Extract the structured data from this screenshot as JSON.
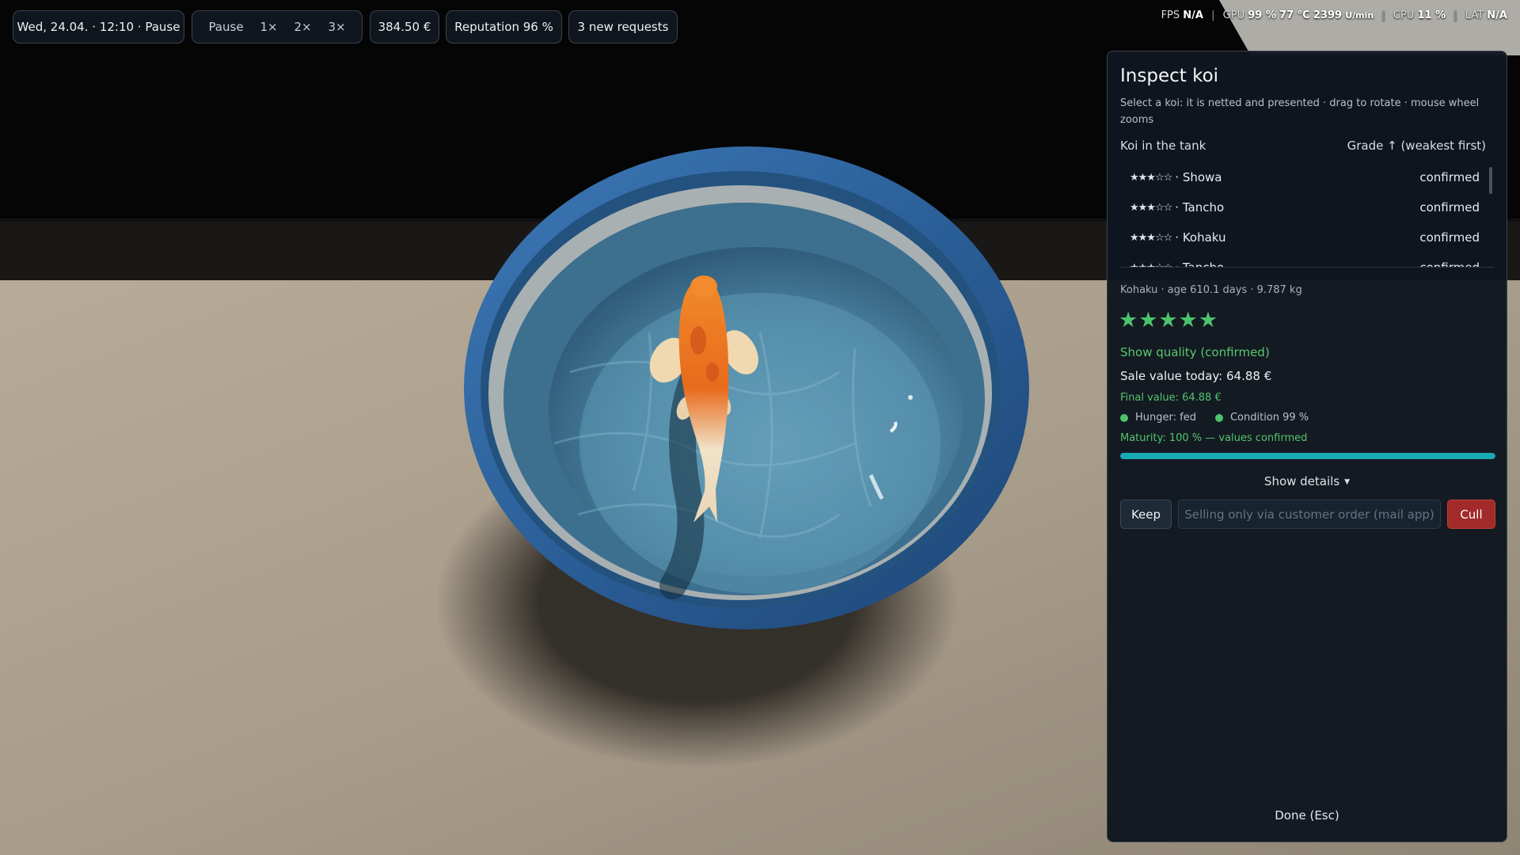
{
  "hud": {
    "datetime": "Wed, 24.04. · 12:10 · Pause",
    "speed": {
      "pause": "Pause",
      "x1": "1×",
      "x2": "2×",
      "x3": "3×"
    },
    "money": "384.50 €",
    "reputation": "Reputation 96 %",
    "requests": "3 new requests"
  },
  "perf": {
    "fps_label": "FPS",
    "fps_value": "N/A",
    "gpu_label": "GPU",
    "gpu_load": "99 %",
    "gpu_temp": "77 °C",
    "gpu_rpm": "2399",
    "gpu_rpm_unit": "U/min",
    "cpu_label": "CPU",
    "cpu_value": "11 %",
    "lat_label": "LAT",
    "lat_value": "N/A"
  },
  "panel": {
    "title": "Inspect koi",
    "subtitle": "Select a koi: it is netted and presented · drag to rotate · mouse wheel zooms",
    "list_header": "Koi in the tank",
    "sort_label": "Grade ↑ (weakest first)",
    "koi": [
      {
        "stars": "★★★☆☆",
        "name": " · Showa",
        "status": "confirmed"
      },
      {
        "stars": "★★★☆☆",
        "name": " · Tancho",
        "status": "confirmed"
      },
      {
        "stars": "★★★☆☆",
        "name": " · Kohaku",
        "status": "confirmed"
      },
      {
        "stars": "★★★☆☆",
        "name": " · Tancho",
        "status": "confirmed"
      }
    ],
    "meta": "Kohaku · age 610.1 days · 9.787 kg",
    "rating": "★★★★★",
    "quality": "Show quality (confirmed)",
    "sale_value": "Sale value today: 64.88 €",
    "final_value": "Final value: 64.88 €",
    "hunger": "Hunger: fed",
    "condition": "Condition 99 %",
    "maturity": "Maturity: 100 % — values confirmed",
    "maturity_progress": 1.0,
    "details": "Show details",
    "keep": "Keep",
    "sell_disabled": "Selling only via customer order (mail app)",
    "cull": "Cull",
    "done": "Done (Esc)"
  },
  "colors": {
    "accent_green": "#4cc46e",
    "progress": "#1aa8b5",
    "cull_red": "#a22a2a",
    "tub_blue": "#2d5f96"
  },
  "icons": {
    "star": "star-icon",
    "status_dot": "status-dot-icon",
    "caret": "chevron-down-icon"
  }
}
